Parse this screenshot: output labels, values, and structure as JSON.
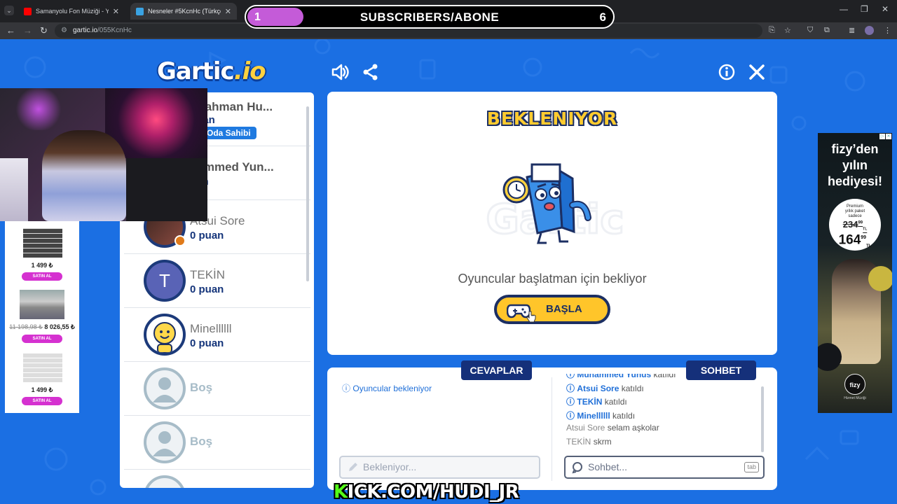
{
  "browser": {
    "tabs": [
      {
        "title": "Samanyolu Fon Müziği - YouTube",
        "favicon_color": "#ff0000"
      },
      {
        "title": "Nesneler #5KcnHc (Türkçe) - Gartic.io",
        "favicon_color": "#3aa3e3"
      }
    ],
    "url_host": "gartic.io",
    "url_path": "/055KcnHc"
  },
  "overlay": {
    "subs_current": "1",
    "subs_label": "SUBSCRIBERS/ABONE",
    "subs_goal": "6",
    "subs_progress": 0.17,
    "kick_prefix": "K",
    "kick_rest": "ICK.COM/HUDI_JR"
  },
  "game": {
    "logo_main": "Gartic",
    "logo_suffix": ".io",
    "status_title": "BEKLENIYOR",
    "wait_message": "Oyuncular başlatman için bekliyor",
    "start_button": "BAŞLA",
    "tab_answers": "CEVAPLAR",
    "tab_chat": "SOHBET",
    "answers_info": "Oyuncular bekleniyor",
    "answer_placeholder": "Bekleniyor...",
    "chat_placeholder": "Sohbet...",
    "chat_tab_key": "tab"
  },
  "players": [
    {
      "name": "dırahman Hu...",
      "points": "puan",
      "badge": "Oda Sahibi"
    },
    {
      "name": "hammed Yun...",
      "points": "uan"
    },
    {
      "name": "Atsui Sore",
      "points": "0 puan"
    },
    {
      "name": "TEKİN",
      "points": "0 puan",
      "initial": "T"
    },
    {
      "name": "Minellllll",
      "points": "0 puan"
    },
    {
      "name": "Boş"
    },
    {
      "name": "Boş"
    }
  ],
  "chat": [
    {
      "user": "Muhammed Yunus",
      "text": "katıldı",
      "system": true
    },
    {
      "user": "Atsui Sore",
      "text": "katıldı",
      "system": true
    },
    {
      "user": "TEKİN",
      "text": "katıldı",
      "system": true
    },
    {
      "user": "Minellllll",
      "text": "katıldı",
      "system": true
    },
    {
      "user": "Atsui Sore",
      "text": "selam aşkolar",
      "system": false
    },
    {
      "user": "TEKİN",
      "text": "skrm",
      "system": false
    }
  ],
  "left_ad": {
    "items": [
      {
        "price": "1 499 ₺",
        "button": "SATIN AL"
      },
      {
        "old_price": "11 198,98 ₺",
        "price": "8 026,55 ₺",
        "button": "SATIN AL"
      },
      {
        "price": "1 499 ₺",
        "button": "SATIN AL"
      }
    ]
  },
  "right_ad": {
    "headline_1": "fizy’den",
    "headline_2": "yılın",
    "headline_3": "hediyesi!",
    "premium_1": "Premium",
    "premium_2": "yıllık paket",
    "premium_3": "sadece",
    "old_price": "234",
    "old_cents": "99",
    "new_price": "164",
    "new_cents": "99",
    "currency": "TL",
    "brand": "fizy",
    "brand_sub": "Hizmet Müziği"
  }
}
